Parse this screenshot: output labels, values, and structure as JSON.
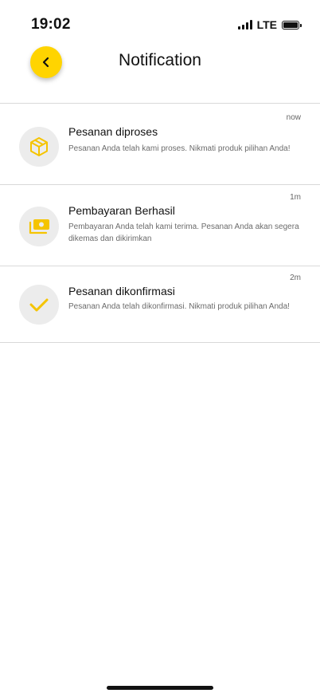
{
  "status_bar": {
    "time": "19:02",
    "network": "LTE"
  },
  "header": {
    "title": "Notification",
    "back_icon": "chevron-left-icon"
  },
  "colors": {
    "accent": "#FFD400",
    "icon_bg": "#ECECEC",
    "divider": "#D9D9D9"
  },
  "notifications": [
    {
      "title": "Pesanan diproses",
      "body": "Pesanan Anda telah kami proses. Nikmati produk pilihan Anda!",
      "time": "now",
      "icon": "package-icon"
    },
    {
      "title": "Pembayaran Berhasil",
      "body": "Pembayaran Anda telah kami terima. Pesanan Anda akan segera dikemas dan dikirimkan",
      "time": "1m",
      "icon": "money-icon"
    },
    {
      "title": "Pesanan dikonfirmasi",
      "body": "Pesanan Anda telah dikonfirmasi. Nikmati produk pilihan Anda!",
      "time": "2m",
      "icon": "checkmark-icon"
    }
  ]
}
